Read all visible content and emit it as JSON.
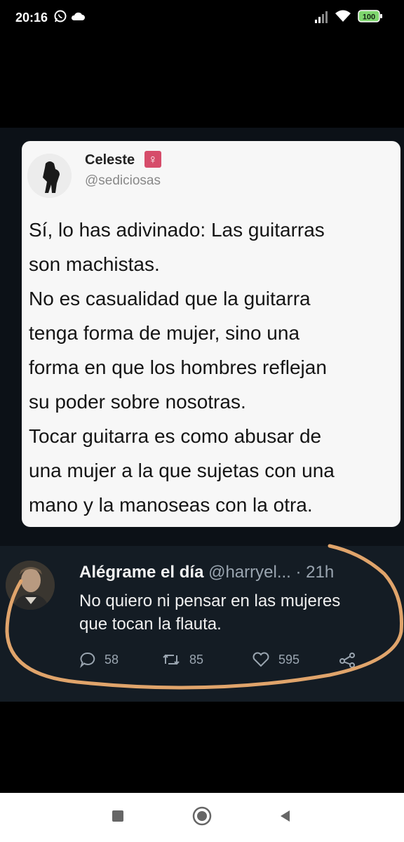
{
  "status_bar": {
    "time": "20:16",
    "battery": "100",
    "icons": [
      "whatsapp-icon",
      "cloud-icon",
      "signal-icon",
      "wifi-icon",
      "battery-icon"
    ]
  },
  "tweet": {
    "name": "Celeste",
    "badge": "♀",
    "handle": "@sediciosas",
    "text": "Sí, lo has adivinado: Las guitarras\nson machistas.\nNo es casualidad que la guitarra\ntenga forma de mujer, sino una\nforma en que los hombres reflejan\nsu poder sobre nosotras.\nTocar guitarra es como abusar de\nuna mujer a la que sujetas con una\nmano y la manoseas con la otra."
  },
  "reply": {
    "name": "Alégrame el día",
    "handle": "@harryel...",
    "separator": "·",
    "time": "21h",
    "text": "No quiero ni pensar en las mujeres\nque tocan la flauta.",
    "replies": "58",
    "retweets": "85",
    "likes": "595"
  },
  "colors": {
    "annotation": "#e0a46b",
    "card_bg": "#f7f7f7",
    "reply_bg": "#141c24",
    "badge": "#d64c6a"
  },
  "nav": [
    "square-icon",
    "home-circle-icon",
    "back-triangle-icon"
  ]
}
